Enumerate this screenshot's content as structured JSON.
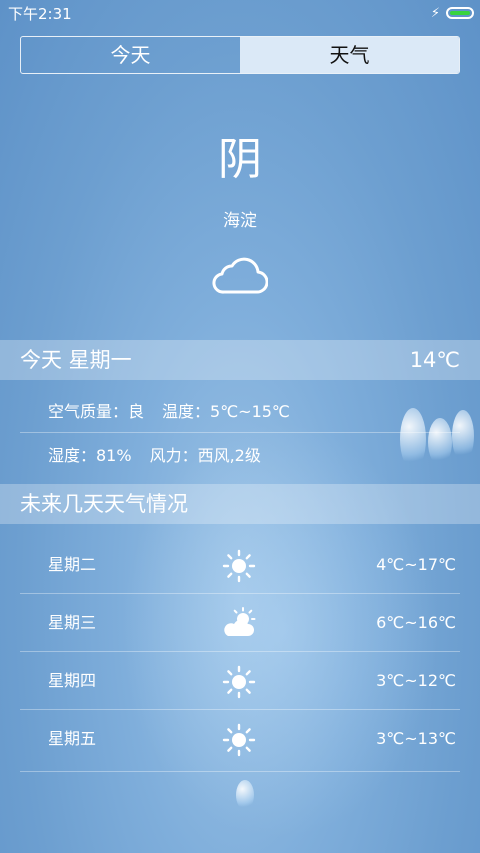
{
  "status": {
    "time": "下午2:31",
    "charging": "⚡",
    "battery_level": 1.0
  },
  "tabs": [
    {
      "label": "今天",
      "active": false
    },
    {
      "label": "天气",
      "active": true
    }
  ],
  "current": {
    "condition": "阴",
    "city": "海淀",
    "icon": "cloud-icon"
  },
  "today": {
    "title": "今天 星期一",
    "temp": "14℃",
    "air_quality": "空气质量：良",
    "temp_range": "温度：5℃~15℃",
    "humidity": "湿度：81%",
    "wind": "风力：西风,2级"
  },
  "future": {
    "title": "未来几天天气情况",
    "days": [
      {
        "day": "星期二",
        "icon": "sun-icon",
        "range": "4℃~17℃"
      },
      {
        "day": "星期三",
        "icon": "partly-cloudy-icon",
        "range": "6℃~16℃"
      },
      {
        "day": "星期四",
        "icon": "sun-icon",
        "range": "3℃~12℃"
      },
      {
        "day": "星期五",
        "icon": "sun-icon",
        "range": "3℃~13℃"
      }
    ]
  },
  "colors": {
    "battery_fill": "#39d33f",
    "active_tab_bg": "#dbe9f7"
  }
}
